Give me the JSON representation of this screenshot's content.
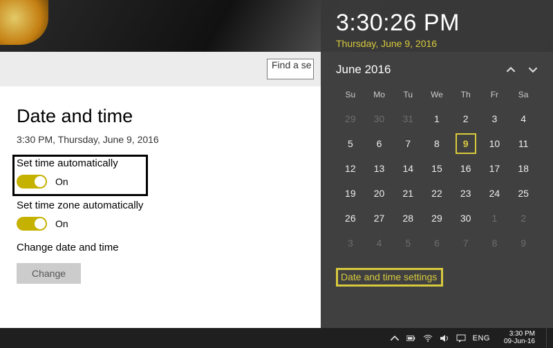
{
  "search": {
    "text": "Find a se"
  },
  "settings": {
    "heading": "Date and time",
    "current": "3:30 PM, Thursday, June 9, 2016",
    "auto_time_label": "Set time automatically",
    "auto_time_state": "On",
    "auto_tz_label": "Set time zone automatically",
    "auto_tz_state": "On",
    "change_label": "Change date and time",
    "change_button": "Change"
  },
  "flyout": {
    "time": "3:30:26 PM",
    "date": "Thursday, June 9, 2016",
    "month": "June 2016",
    "dow": [
      "Su",
      "Mo",
      "Tu",
      "We",
      "Th",
      "Fr",
      "Sa"
    ],
    "weeks": [
      [
        {
          "n": 29,
          "dim": true
        },
        {
          "n": 30,
          "dim": true
        },
        {
          "n": 31,
          "dim": true
        },
        {
          "n": 1
        },
        {
          "n": 2
        },
        {
          "n": 3
        },
        {
          "n": 4
        }
      ],
      [
        {
          "n": 5
        },
        {
          "n": 6
        },
        {
          "n": 7
        },
        {
          "n": 8
        },
        {
          "n": 9,
          "today": true
        },
        {
          "n": 10
        },
        {
          "n": 11
        }
      ],
      [
        {
          "n": 12
        },
        {
          "n": 13
        },
        {
          "n": 14
        },
        {
          "n": 15
        },
        {
          "n": 16
        },
        {
          "n": 17
        },
        {
          "n": 18
        }
      ],
      [
        {
          "n": 19
        },
        {
          "n": 20
        },
        {
          "n": 21
        },
        {
          "n": 22
        },
        {
          "n": 23
        },
        {
          "n": 24
        },
        {
          "n": 25
        }
      ],
      [
        {
          "n": 26
        },
        {
          "n": 27
        },
        {
          "n": 28
        },
        {
          "n": 29
        },
        {
          "n": 30
        },
        {
          "n": 1,
          "dim": true
        },
        {
          "n": 2,
          "dim": true
        }
      ],
      [
        {
          "n": 3,
          "dim": true
        },
        {
          "n": 4,
          "dim": true
        },
        {
          "n": 5,
          "dim": true
        },
        {
          "n": 6,
          "dim": true
        },
        {
          "n": 7,
          "dim": true
        },
        {
          "n": 8,
          "dim": true
        },
        {
          "n": 9,
          "dim": true
        }
      ]
    ],
    "settings_link": "Date and time settings"
  },
  "taskbar": {
    "lang": "ENG",
    "time": "3:30 PM",
    "date": "09-Jun-16"
  }
}
